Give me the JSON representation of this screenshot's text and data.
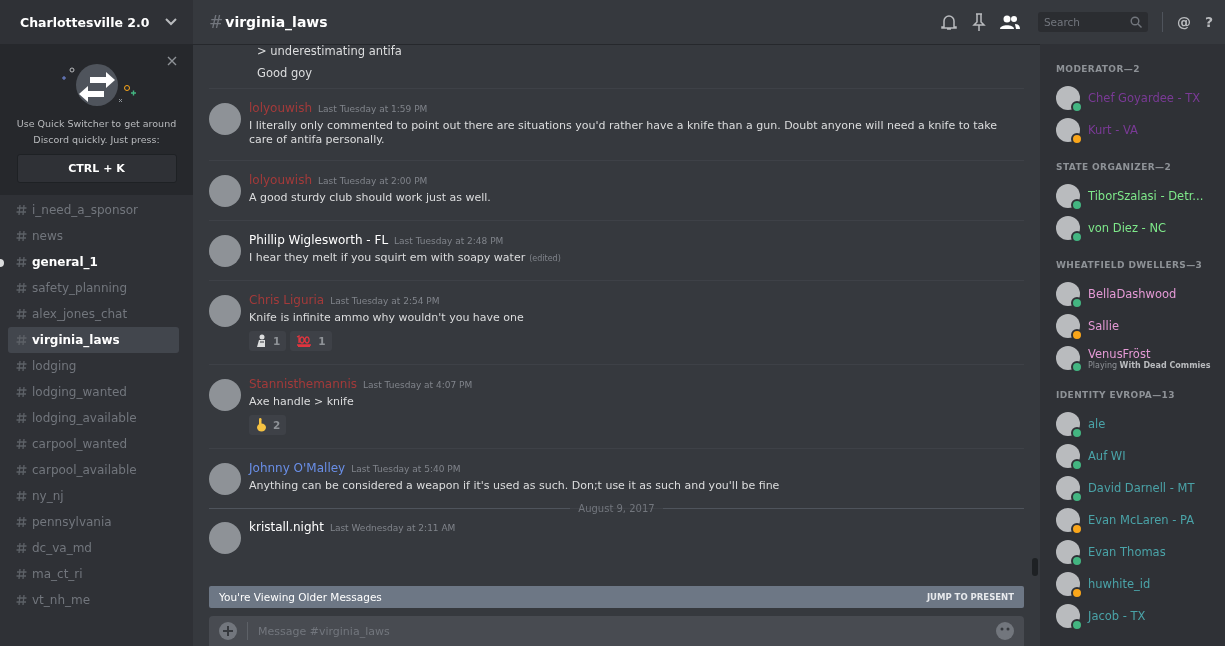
{
  "server": {
    "name": "Charlottesville 2.0"
  },
  "quick_switcher": {
    "text": "Use Quick Switcher to get around Discord quickly. Just press:",
    "shortcut": "CTRL + K"
  },
  "channels": [
    {
      "name": "i_need_a_sponsor",
      "selected": false,
      "unread": false
    },
    {
      "name": "news",
      "selected": false,
      "unread": false
    },
    {
      "name": "general_1",
      "selected": false,
      "unread": true
    },
    {
      "name": "safety_planning",
      "selected": false,
      "unread": false
    },
    {
      "name": "alex_jones_chat",
      "selected": false,
      "unread": false
    },
    {
      "name": "virginia_laws",
      "selected": true,
      "unread": false
    },
    {
      "name": "lodging",
      "selected": false,
      "unread": false
    },
    {
      "name": "lodging_wanted",
      "selected": false,
      "unread": false
    },
    {
      "name": "lodging_available",
      "selected": false,
      "unread": false
    },
    {
      "name": "carpool_wanted",
      "selected": false,
      "unread": false
    },
    {
      "name": "carpool_available",
      "selected": false,
      "unread": false
    },
    {
      "name": "ny_nj",
      "selected": false,
      "unread": false
    },
    {
      "name": "pennsylvania",
      "selected": false,
      "unread": false
    },
    {
      "name": "dc_va_md",
      "selected": false,
      "unread": false
    },
    {
      "name": "ma_ct_ri",
      "selected": false,
      "unread": false
    },
    {
      "name": "vt_nh_me",
      "selected": false,
      "unread": false
    }
  ],
  "header": {
    "hash": "#",
    "channel": "virginia_laws",
    "search_placeholder": "Search",
    "mention": "@",
    "help": "?"
  },
  "continued_lines": [
    "> underestimating antifa",
    "Good goy"
  ],
  "messages": [
    {
      "author": "lolyouwish",
      "color": "#a33a3a",
      "time": "Last Tuesday at 1:59 PM",
      "text": "I literally only commented to point out there are situations you'd rather have a knife than a gun. Doubt anyone will need a knife to take care of antifa personally."
    },
    {
      "author": "lolyouwish",
      "color": "#a33a3a",
      "time": "Last Tuesday at 2:00 PM",
      "text": "A good sturdy club should work just as well."
    },
    {
      "author": "Phillip Wiglesworth - FL",
      "color": "#ffffff",
      "time": "Last Tuesday at 2:48 PM",
      "text": "I hear they melt if you squirt em with soapy water",
      "edited_label": "(edited)"
    },
    {
      "author": "Chris Liguria",
      "color": "#a33a3a",
      "time": "Last Tuesday at 2:54 PM",
      "text": "Knife is infinite ammo why wouldn't you have one",
      "reactions": [
        {
          "kind": "figure",
          "count": "1"
        },
        {
          "kind": "hundred",
          "count": "1"
        }
      ]
    },
    {
      "author": "Stannisthemannis",
      "color": "#a33a3a",
      "time": "Last Tuesday at 4:07 PM",
      "text": "Axe handle > knife",
      "reactions": [
        {
          "kind": "finger",
          "count": "2"
        }
      ]
    },
    {
      "author": "Johnny O'Malley",
      "color": "#6a8fe8",
      "time": "Last Tuesday at 5:40 PM",
      "text": "Anything can be considered a weapon if it's used as such. Don;t use it as such and you'll be fine"
    }
  ],
  "date_divider": "August 9, 2017",
  "last_message": {
    "author": "kristall.night",
    "color": "#ffffff",
    "time": "Last Wednesday at 2:11 AM"
  },
  "older_banner": {
    "text": "You're Viewing Older Messages",
    "action": "JUMP TO PRESENT"
  },
  "composer": {
    "placeholder": "Message #virginia_laws"
  },
  "member_groups": [
    {
      "title": "MODERATOR—2",
      "members": [
        {
          "name": "Chef Goyardee - TX",
          "color": "#7a3a96",
          "status": {
            "color": "#43b581"
          }
        },
        {
          "name": "Kurt - VA",
          "color": "#7a3a96",
          "status": {
            "color": "#faa61a"
          }
        }
      ]
    },
    {
      "title": "STATE ORGANIZER—2",
      "members": [
        {
          "name": "TiborSzalasi - Detr...",
          "color": "#7ee88a",
          "status": {
            "color": "#43b581"
          }
        },
        {
          "name": "von Diez - NC",
          "color": "#7ee88a",
          "status": {
            "color": "#43b581"
          }
        }
      ]
    },
    {
      "title": "WHEATFIELD DWELLERS—3",
      "members": [
        {
          "name": "BellaDashwood",
          "color": "#e59ad6",
          "status": {
            "color": "#43b581"
          }
        },
        {
          "name": "Sallie",
          "color": "#e59ad6",
          "status": {
            "color": "#faa61a"
          }
        },
        {
          "name": "VenusFröst",
          "color": "#e59ad6",
          "status": {
            "color": "#43b581"
          },
          "activity": "Playing **With Dead Commies**"
        }
      ]
    },
    {
      "title": "IDENTITY EVROPA—13",
      "members": [
        {
          "name": "ale",
          "color": "#4aa3a8",
          "status": {
            "color": "#43b581"
          }
        },
        {
          "name": "Auf WI",
          "color": "#4aa3a8",
          "status": {
            "color": "#43b581"
          }
        },
        {
          "name": "David Darnell - MT",
          "color": "#4aa3a8",
          "status": {
            "color": "#43b581"
          }
        },
        {
          "name": "Evan McLaren - PA",
          "color": "#4aa3a8",
          "status": {
            "color": "#faa61a"
          }
        },
        {
          "name": "Evan Thomas",
          "color": "#4aa3a8",
          "status": {
            "color": "#43b581"
          }
        },
        {
          "name": "huwhite_id",
          "color": "#4aa3a8",
          "status": {
            "color": "#faa61a"
          }
        },
        {
          "name": "Jacob - TX",
          "color": "#4aa3a8",
          "status": {
            "color": "#43b581"
          }
        }
      ]
    }
  ]
}
